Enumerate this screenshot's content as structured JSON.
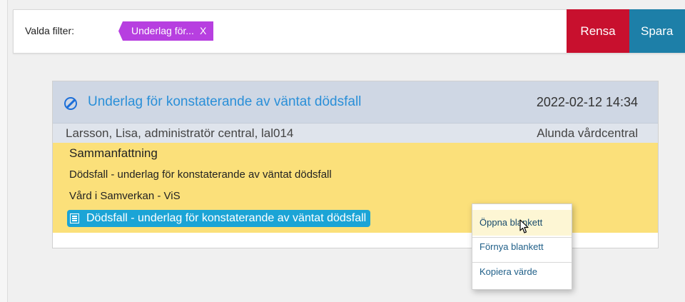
{
  "filter": {
    "label": "Valda filter:",
    "chip_label": "Underlag för...",
    "chip_remove": "X",
    "rensa": "Rensa",
    "spara": "Spara"
  },
  "card": {
    "title": "Underlag för konstaterande av väntat dödsfall",
    "date": "2022-02-12 14:34",
    "author": "Larsson, Lisa, administratör central, lal014",
    "unit": "Alunda vårdcentral",
    "summary_heading": "Sammanfattning",
    "summary_line": "Dödsfall - underlag för konstaterande av väntat dödsfall",
    "category": "Vård i Samverkan - ViS",
    "form_link": "Dödsfall - underlag för konstaterande av väntat dödsfall"
  },
  "context_menu": {
    "items": [
      "Öppna blankett",
      "Förnya blankett",
      "Kopiera värde"
    ]
  },
  "colors": {
    "rensa": "#c8102e",
    "spara": "#1d7fa8",
    "chip": "#b73fe0",
    "header": "#cfd7e4",
    "body": "#fbe07a",
    "link": "#1ba4d6"
  },
  "icons": {
    "status": "blocked-icon",
    "form": "form-list-icon",
    "cursor": "mouse-pointer-icon"
  }
}
